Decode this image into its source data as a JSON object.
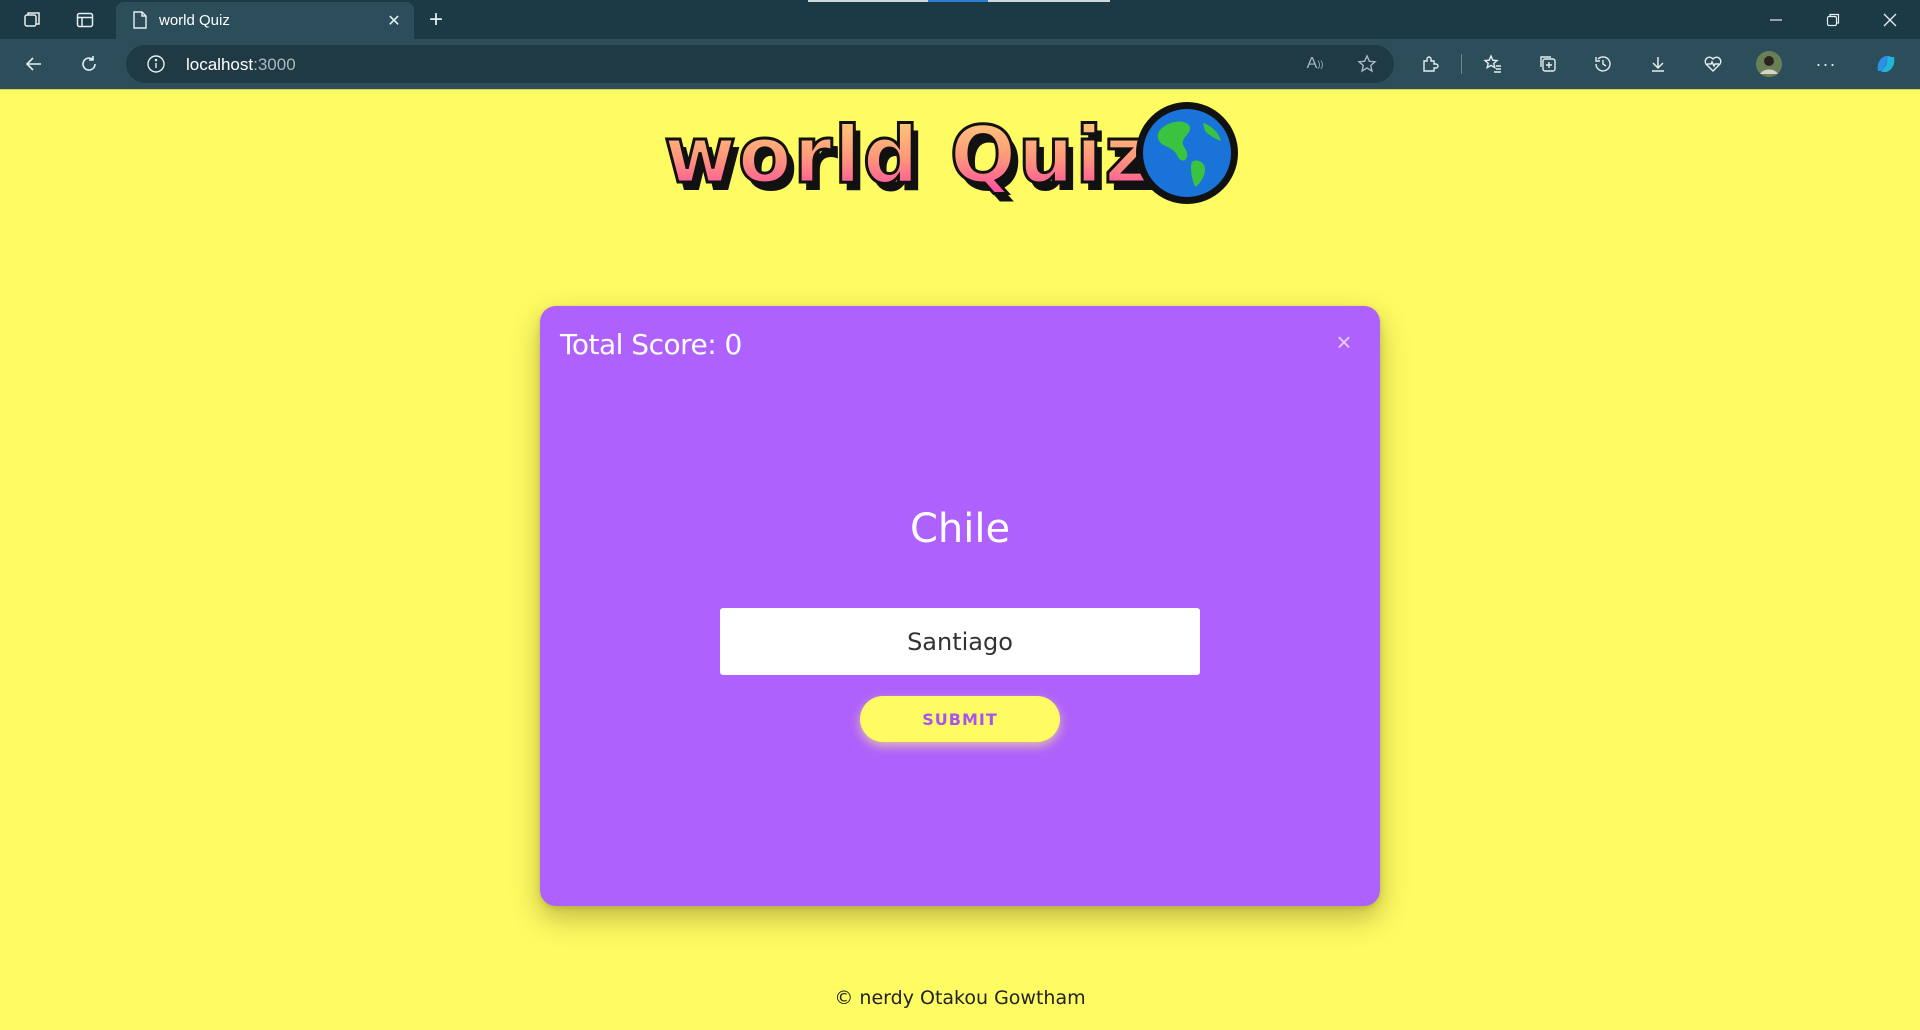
{
  "browser": {
    "tab_title": "world Quiz",
    "url_host": "localhost",
    "url_port": ":3000"
  },
  "logo": {
    "text": "world Quiz",
    "icon": "globe-icon"
  },
  "quiz": {
    "score_label": "Total Score: 0",
    "close_symbol": "×",
    "country": "Chile",
    "answer_value": "Santiago",
    "submit_label": "SUBMIT"
  },
  "footer": {
    "text": "© nerdy Otakou Gowtham"
  },
  "colors": {
    "page_bg": "#fefb63",
    "card_bg": "#af61fd",
    "submit_text": "#a655f0",
    "chrome_dark": "#1c3a45",
    "chrome_toolbar": "#2c4e5a"
  }
}
